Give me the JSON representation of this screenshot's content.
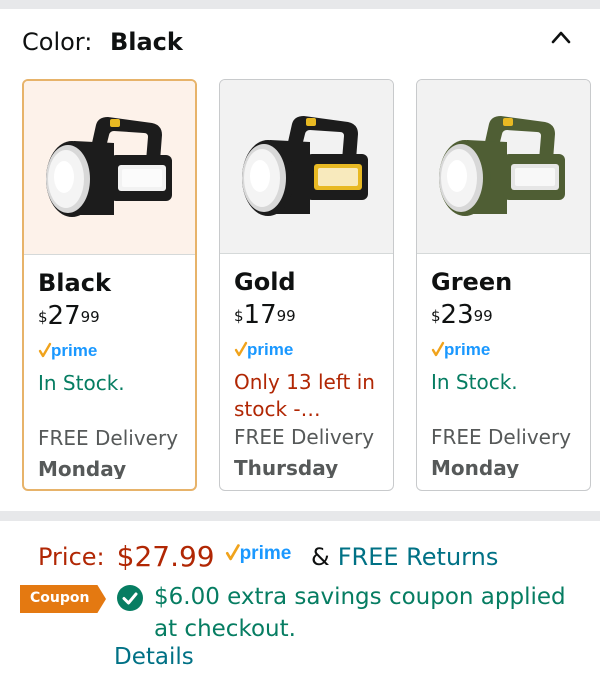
{
  "color_selector": {
    "label": "Color:",
    "selected_value": "Black",
    "collapse_icon": "chevron-up-icon"
  },
  "variants": [
    {
      "name": "Black",
      "price_symbol": "$",
      "price_dollars": "27",
      "price_cents": "99",
      "prime": "prime",
      "stock": "In Stock.",
      "delivery": "FREE Delivery",
      "delivery_day": "Monday",
      "selected": true,
      "body_color": "#1c1c1c",
      "accent_color": "#f2f2f2"
    },
    {
      "name": "Gold",
      "price_symbol": "$",
      "price_dollars": "17",
      "price_cents": "99",
      "prime": "prime",
      "stock": "Only 13 left in stock -…",
      "delivery": "FREE Delivery",
      "delivery_day": "Thursday",
      "selected": false,
      "body_color": "#1c1c1c",
      "accent_color": "#e8b923"
    },
    {
      "name": "Green",
      "price_symbol": "$",
      "price_dollars": "23",
      "price_cents": "99",
      "prime": "prime",
      "stock": "In Stock.",
      "delivery": "FREE Delivery",
      "delivery_day": "Monday",
      "selected": false,
      "body_color": "#4f5e34",
      "accent_color": "#e6e6e6"
    }
  ],
  "price_section": {
    "label": "Price:",
    "value": "$27.99",
    "prime": "prime",
    "ampersand": "&",
    "free_returns": "FREE Returns"
  },
  "coupon": {
    "badge": "Coupon",
    "text": "$6.00 extra savings coupon applied at checkout.",
    "details_link": "Details"
  },
  "colors": {
    "price_red": "#b12704",
    "in_stock_green": "#067d62",
    "link_teal": "#007185",
    "prime_blue": "#1a98ff",
    "prime_check": "#f0a31c",
    "coupon_orange": "#e47911",
    "selected_border": "#e7b36a"
  }
}
